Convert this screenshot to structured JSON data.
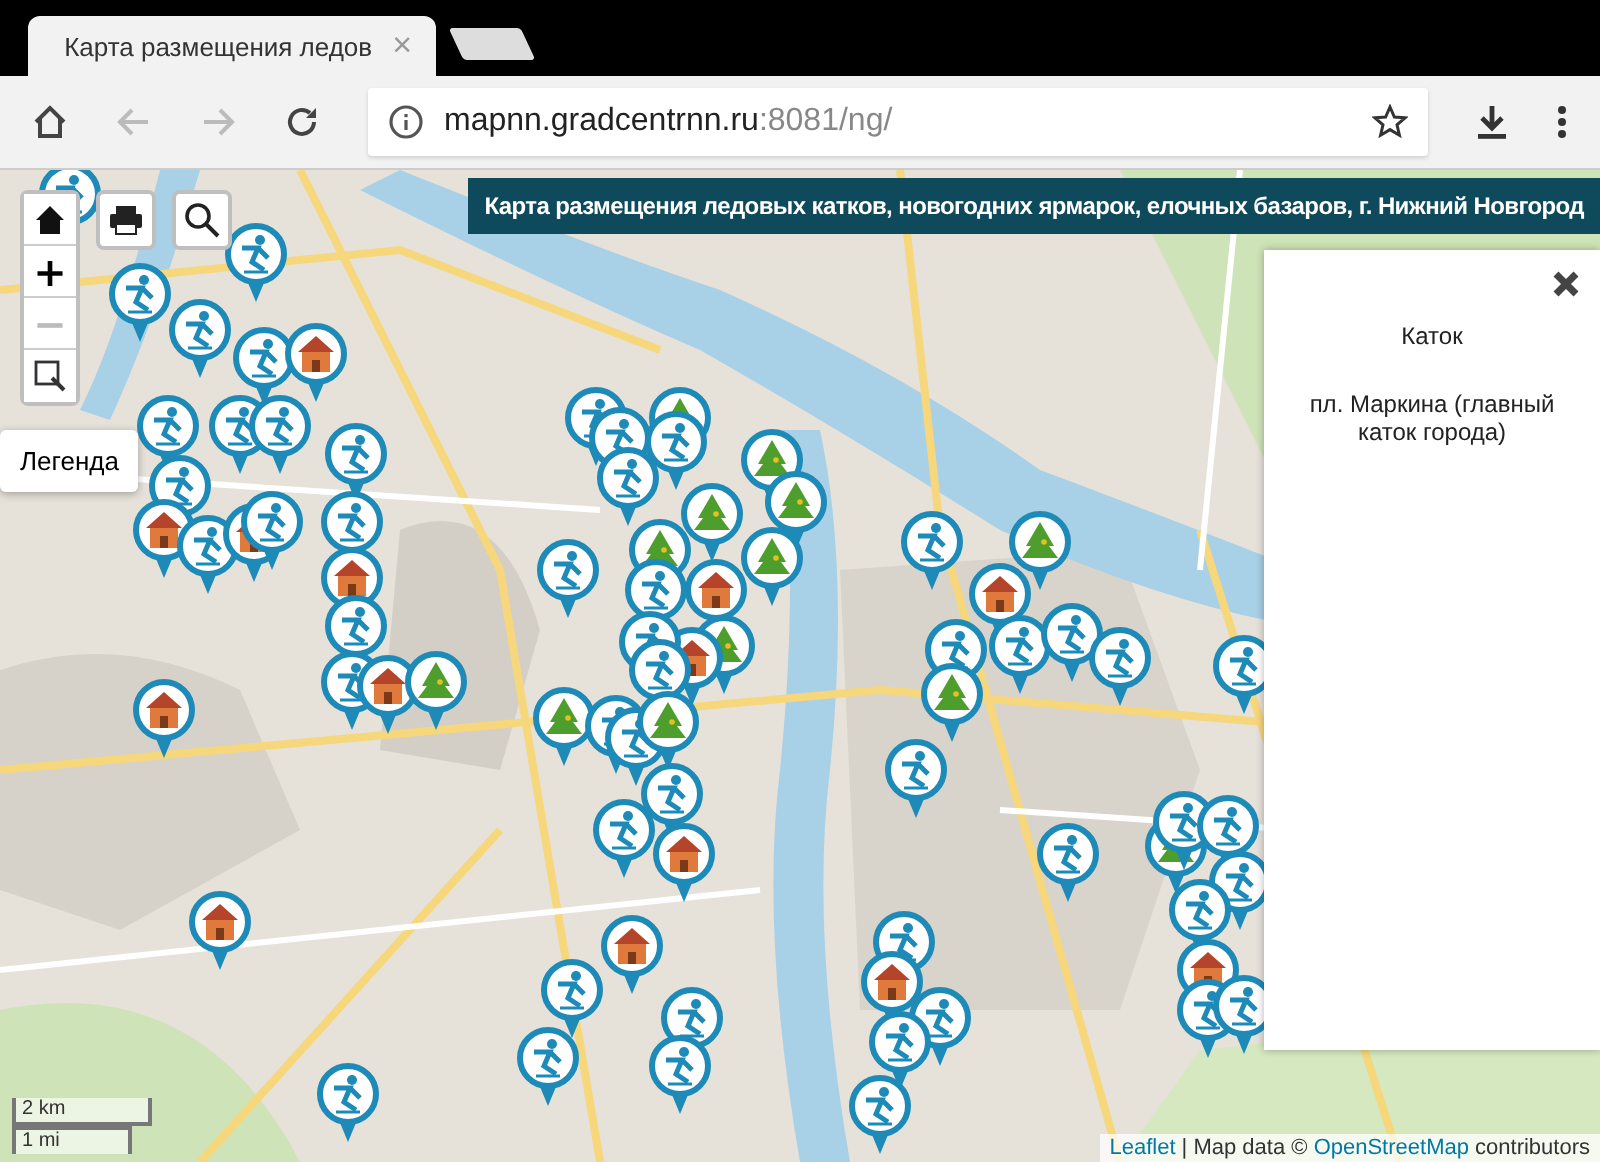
{
  "browser": {
    "tabs": [
      {
        "title": "Карта размещения ледов",
        "close": "×",
        "selected": true
      }
    ],
    "address": {
      "host": "mapnn.gradcentrnn.ru",
      "path": ":8081/ng/"
    },
    "back_disabled": true,
    "forward_disabled": true
  },
  "map": {
    "zoom_in": {
      "label": "+",
      "disabled": false
    },
    "zoom_out": {
      "label": "−",
      "disabled": true
    },
    "legend_button": "Легенда",
    "banner": "Карта размещения ледовых катков, новогодних ярмарок, елочных базаров, г. Нижний Новгород",
    "popup": {
      "title": "Каток",
      "text": "пл. Маркина (главный каток города)"
    },
    "scale": [
      "2 km",
      "1 mi"
    ],
    "attribution": {
      "leaflet": "Leaflet",
      "text": "| Map data ©",
      "osm": "OpenStreetMap",
      "tail": "contributors"
    }
  }
}
